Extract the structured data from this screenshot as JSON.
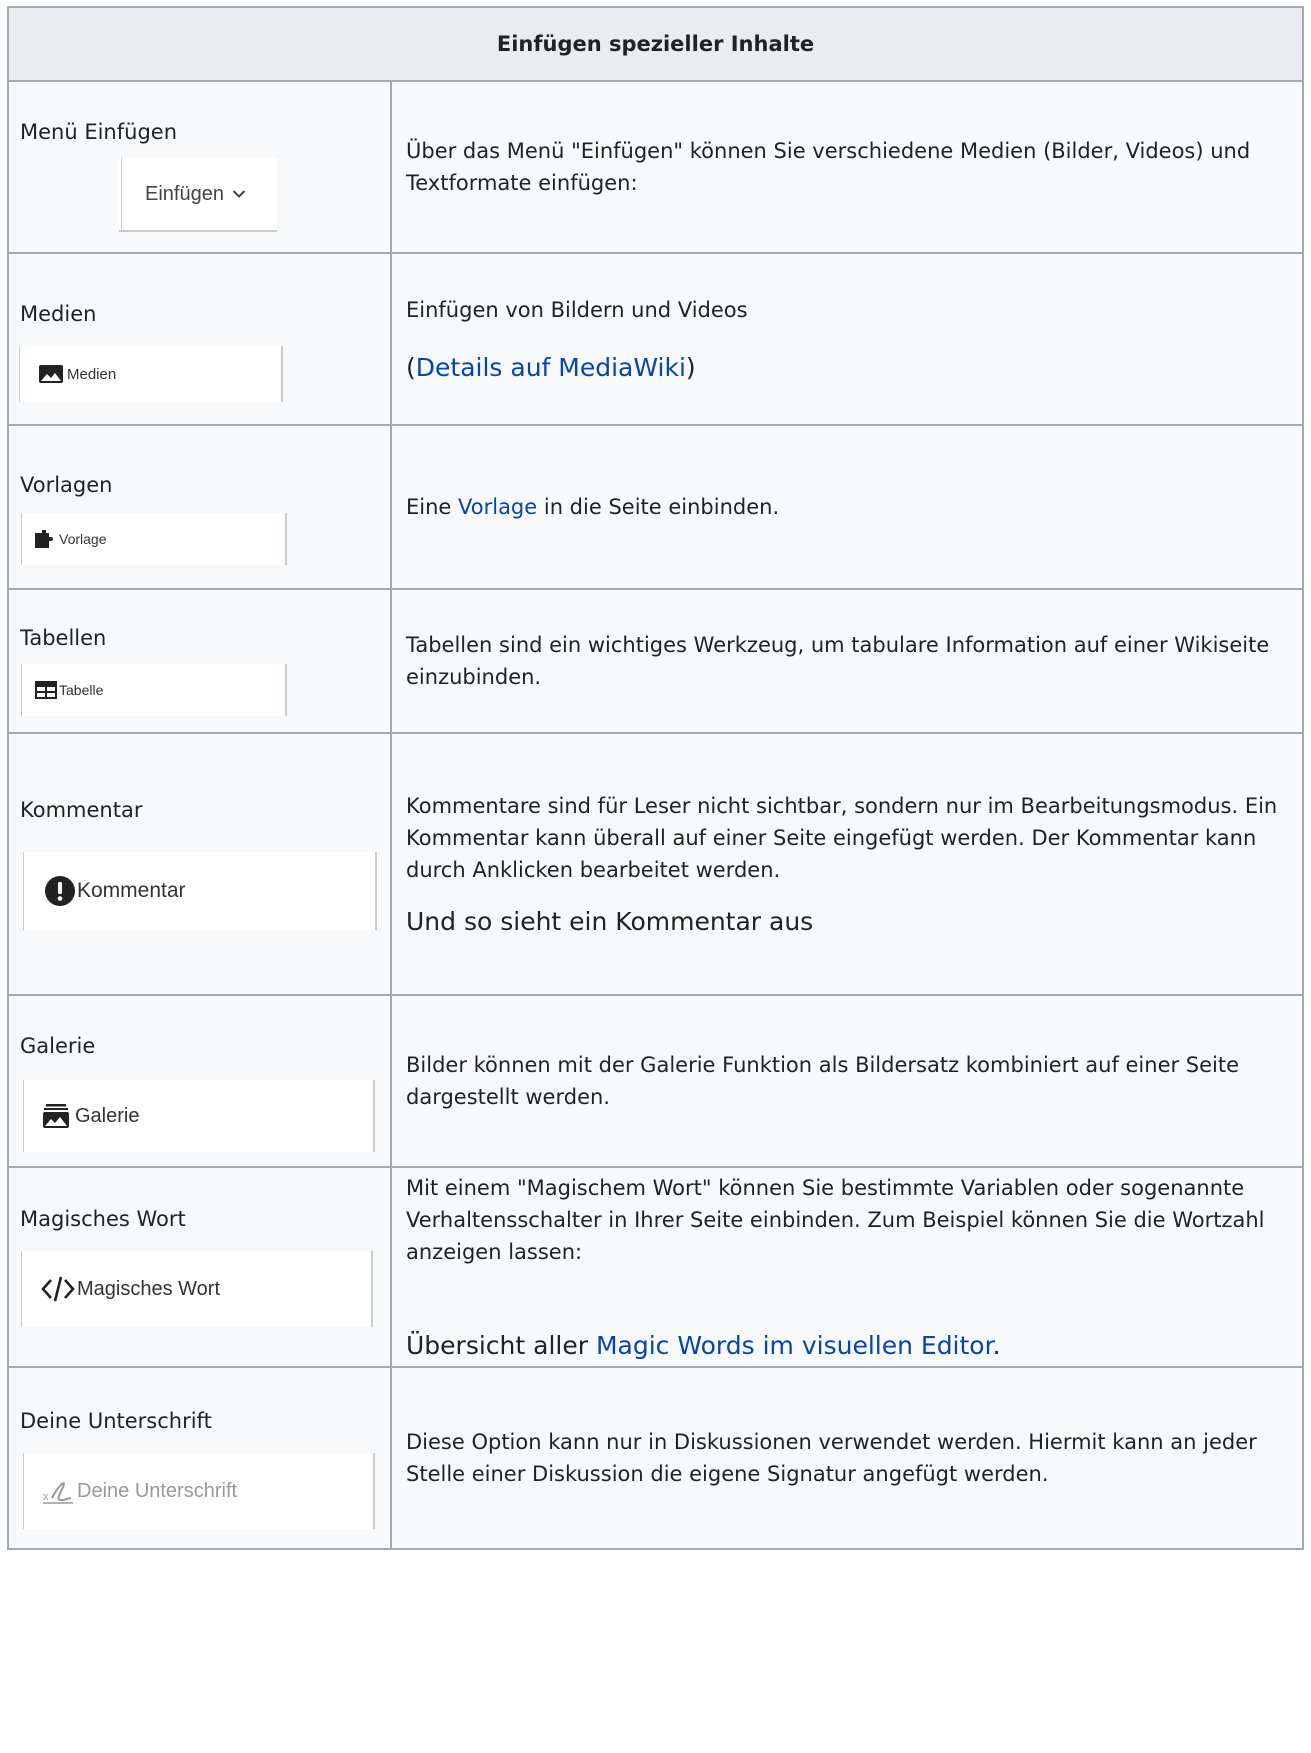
{
  "header": "Einfügen spezieller Inhalte",
  "rows": [
    {
      "feature": "Menü Einfügen",
      "button": {
        "label": "Einfügen",
        "icon": "chevron-down-icon"
      },
      "description": "Über das Menü \"Einfügen\" können Sie verschiedene Medien (Bilder, Videos) und Textformate einfügen:"
    },
    {
      "feature": "Medien",
      "button": {
        "label": "Medien",
        "icon": "image-icon"
      },
      "description": "Einfügen von Bildern und Videos",
      "paren_open": "(",
      "link": "Details auf MediaWiki",
      "paren_close": ")"
    },
    {
      "feature": "Vorlagen",
      "button": {
        "label": "Vorlage",
        "icon": "puzzle-icon"
      },
      "desc_before": "Eine ",
      "link": "Vorlage",
      "desc_after": " in die Seite einbinden."
    },
    {
      "feature": "Tabellen",
      "button": {
        "label": "Tabelle",
        "icon": "table-icon"
      },
      "description": "Tabellen sind ein wichtiges Werkzeug, um tabulare Information auf einer Wikiseite einzubinden."
    },
    {
      "feature": "Kommentar",
      "button": {
        "label": "Kommentar",
        "icon": "alert-circle-icon"
      },
      "description": "Kommentare sind für Leser nicht sichtbar, sondern nur im Bearbeitungsmodus. Ein Kommentar kann überall auf einer Seite eingefügt werden. Der Kommentar kann durch Anklicken bearbeitet werden.",
      "example": "Und so sieht ein Kommentar aus"
    },
    {
      "feature": "Galerie",
      "button": {
        "label": "Galerie",
        "icon": "gallery-icon"
      },
      "description": "Bilder können mit der Galerie Funktion als Bildersatz kombiniert auf einer Seite dargestellt werden."
    },
    {
      "feature": "Magisches Wort",
      "button": {
        "label": "Magisches Wort",
        "icon": "code-icon"
      },
      "description": "Mit einem \"Magischem Wort\" können Sie bestimmte Variablen oder sogenannte Verhaltensschalter in Ihrer Seite einbinden. Zum Beispiel können Sie die Wortzahl anzeigen lassen:",
      "overview_before": "Übersicht aller ",
      "link": "Magic Words im visuellen Editor",
      "overview_after": "."
    },
    {
      "feature": "Deine Unterschrift",
      "button": {
        "label": "Deine Unterschrift",
        "icon": "signature-icon"
      },
      "description": "Diese Option kann nur in Diskussionen verwendet werden. Hiermit kann an jeder Stelle einer Diskussion die eigene Signatur angefügt werden."
    }
  ]
}
